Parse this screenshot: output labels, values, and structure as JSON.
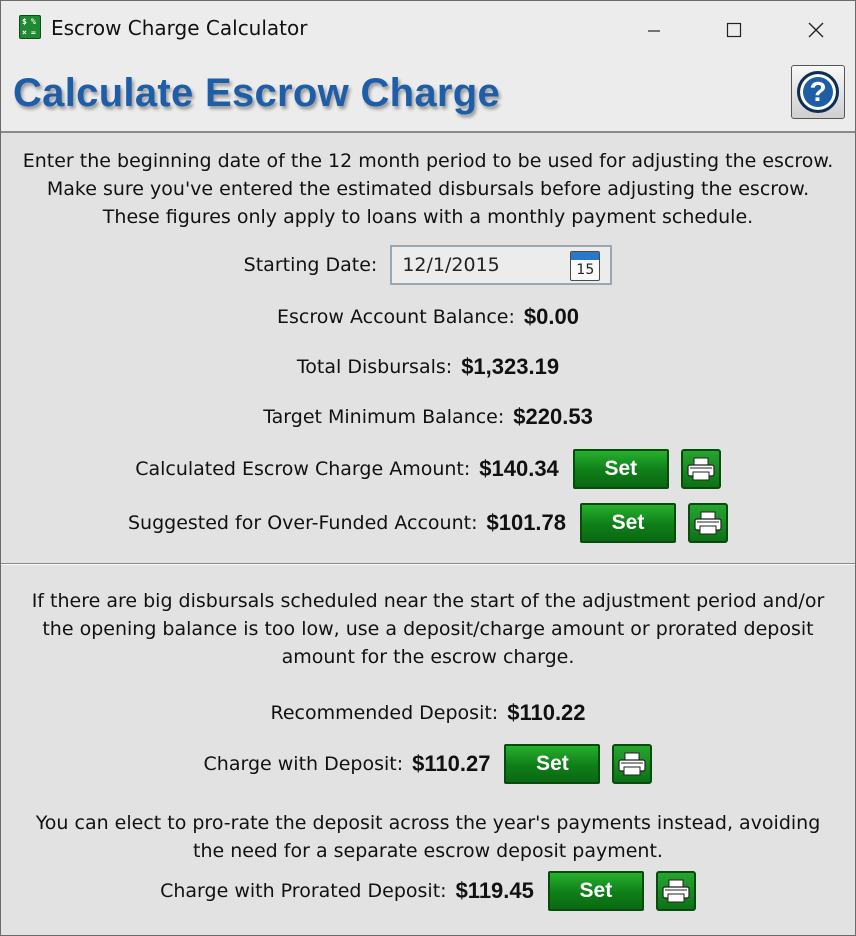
{
  "window": {
    "title": "Escrow Charge Calculator",
    "icon": "calculator-icon",
    "controls": [
      "minimize",
      "maximize",
      "close"
    ]
  },
  "header": {
    "title": "Calculate Escrow Charge",
    "help_icon_label": "?"
  },
  "intro_text": "Enter the beginning date of the 12 month period to be used for adjusting the escrow. Make sure you've entered the estimated disbursals before adjusting the escrow. These figures only apply to loans with a monthly payment schedule.",
  "starting_date": {
    "label": "Starting Date:",
    "value": "12/1/2015",
    "calendar_day": "15"
  },
  "escrow_balance": {
    "label": "Escrow Account Balance:",
    "value": "$0.00"
  },
  "total_disbursals": {
    "label": "Total Disbursals:",
    "value": "$1,323.19"
  },
  "target_min": {
    "label": "Target Minimum Balance:",
    "value": "$220.53"
  },
  "calculated_charge": {
    "label": "Calculated Escrow Charge Amount:",
    "value": "$140.34",
    "set_label": "Set"
  },
  "over_funded": {
    "label": "Suggested for Over-Funded Account:",
    "value": "$101.78",
    "set_label": "Set"
  },
  "deposit_text": "If there are big disbursals scheduled near the start of the adjustment period and/or the opening balance is too low, use a deposit/charge amount or prorated deposit amount for the escrow charge.",
  "recommended_deposit": {
    "label": "Recommended Deposit:",
    "value": "$110.22"
  },
  "charge_with_deposit": {
    "label": "Charge with Deposit:",
    "value": "$110.27",
    "set_label": "Set"
  },
  "prorate_text": "You can elect to pro-rate the deposit across the year's payments instead, avoiding the need for a separate escrow deposit payment.",
  "charge_prorated": {
    "label": "Charge with Prorated Deposit:",
    "value": "$119.45",
    "set_label": "Set"
  },
  "colors": {
    "header_blue": "#1e5ea8",
    "button_green": "#0f7d19",
    "background": "#e2e2e2"
  }
}
